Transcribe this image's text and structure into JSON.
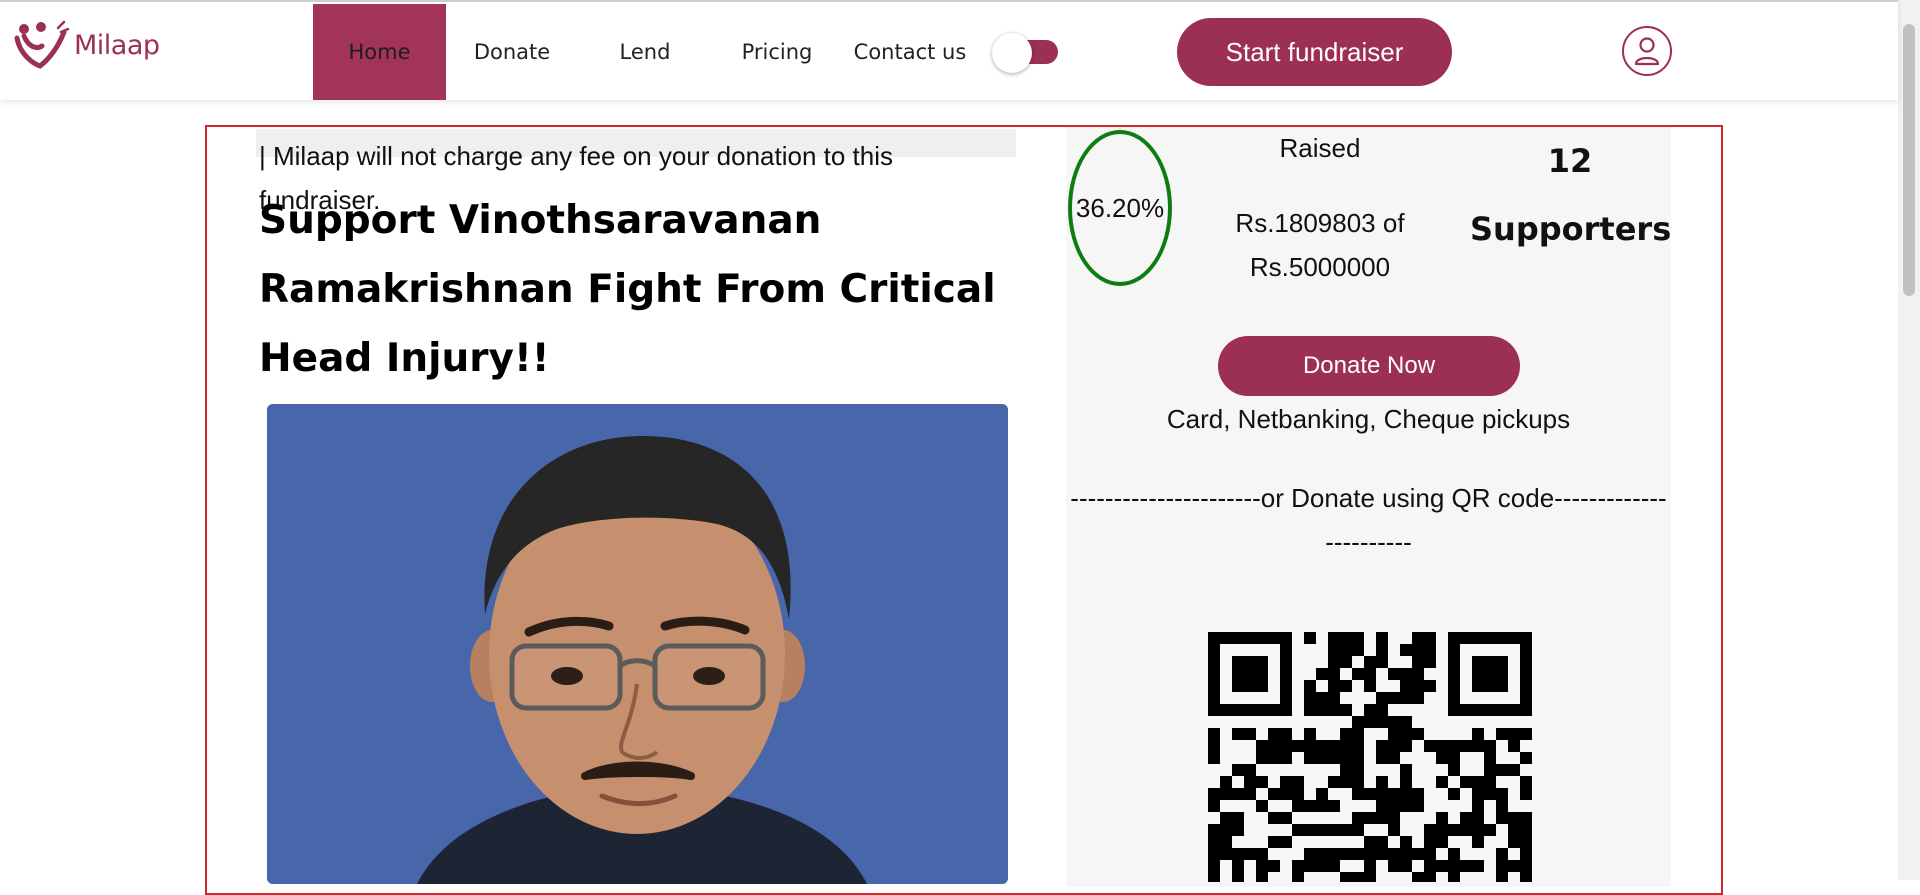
{
  "brand": {
    "name": "Milaap",
    "color": "#9c2f55"
  },
  "nav": {
    "items": [
      {
        "label": "Home",
        "active": true
      },
      {
        "label": "Donate"
      },
      {
        "label": "Lend"
      },
      {
        "label": "Pricing"
      },
      {
        "label": "Contact us"
      }
    ],
    "toggle_state": "off",
    "start_fundraiser_label": "Start fundraiser",
    "profile_icon": "user-icon"
  },
  "campaign": {
    "notice": "| Milaap will not charge any fee on your donation to this fundraiser.",
    "title": "Support Vinothsaravanan Ramakrishnan Fight From Critical Head Injury!!",
    "progress_percent": "36.20%",
    "raised_label": "Raised",
    "raised_amount": "Rs.1809803 of Rs.5000000",
    "supporters_count": "12",
    "supporters_label": "Supporters",
    "donate_label": "Donate Now",
    "payment_methods": "Card, Netbanking, Cheque pickups",
    "qr_divider": "----------------------or Donate using QR code-----------------------"
  },
  "colors": {
    "accent": "#9c2f55",
    "progress_ring": "#0c7d12",
    "outline": "#d8262e",
    "photo_bg": "#4866aa"
  }
}
